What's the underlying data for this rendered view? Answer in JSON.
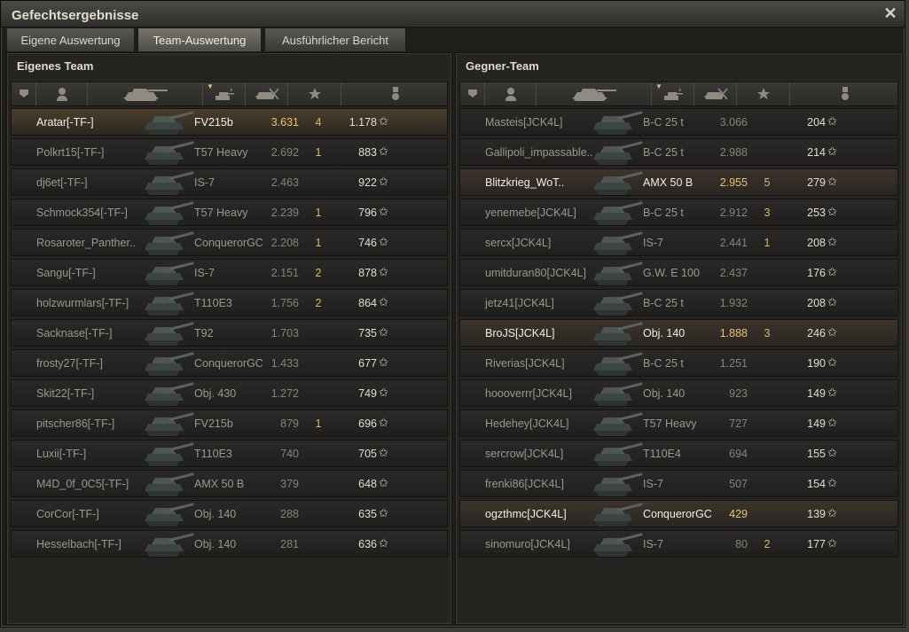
{
  "window": {
    "title": "Gefechtsergebnisse",
    "close_glyph": "✕"
  },
  "tabs": [
    {
      "label": "Eigene Auswertung"
    },
    {
      "label": "Team-Auswertung"
    },
    {
      "label": "Ausführlicher Bericht"
    }
  ],
  "active_tab": 1,
  "columns": [
    "squad-icon",
    "player-icon",
    "tank-icon",
    "damage-icon",
    "kills-icon",
    "xp-star-icon",
    "medal-icon"
  ],
  "own_team": {
    "title": "Eigenes Team",
    "rows": [
      {
        "name": "Aratar[-TF-]",
        "tank": "FV215b",
        "damage": "3.631",
        "kills": "4",
        "xp": "1.178",
        "style": "self"
      },
      {
        "name": "Polkrt15[-TF-]",
        "tank": "T57 Heavy",
        "damage": "2.692",
        "kills": "1",
        "xp": "883"
      },
      {
        "name": "dj6et[-TF-]",
        "tank": "IS-7",
        "damage": "2.463",
        "kills": "",
        "xp": "922"
      },
      {
        "name": "Schmock354[-TF-]",
        "tank": "T57 Heavy",
        "damage": "2.239",
        "kills": "1",
        "xp": "796"
      },
      {
        "name": "Rosaroter_Panther..",
        "tank": "ConquerorGC",
        "damage": "2.208",
        "kills": "1",
        "xp": "746"
      },
      {
        "name": "Sangu[-TF-]",
        "tank": "IS-7",
        "damage": "2.151",
        "kills": "2",
        "xp": "878"
      },
      {
        "name": "holzwurmlars[-TF-]",
        "tank": "T110E3",
        "damage": "1.756",
        "kills": "2",
        "xp": "864"
      },
      {
        "name": "Sacknase[-TF-]",
        "tank": "T92",
        "damage": "1.703",
        "kills": "",
        "xp": "735"
      },
      {
        "name": "frosty27[-TF-]",
        "tank": "ConquerorGC",
        "damage": "1.433",
        "kills": "",
        "xp": "677"
      },
      {
        "name": "Skit22[-TF-]",
        "tank": "Obj. 430",
        "damage": "1.272",
        "kills": "",
        "xp": "749"
      },
      {
        "name": "pitscher86[-TF-]",
        "tank": "FV215b",
        "damage": "879",
        "kills": "1",
        "xp": "696"
      },
      {
        "name": "Luxii[-TF-]",
        "tank": "T110E3",
        "damage": "740",
        "kills": "",
        "xp": "705"
      },
      {
        "name": "M4D_0f_0C5[-TF-]",
        "tank": "AMX 50 B",
        "damage": "379",
        "kills": "",
        "xp": "648"
      },
      {
        "name": "CorCor[-TF-]",
        "tank": "Obj. 140",
        "damage": "288",
        "kills": "",
        "xp": "635"
      },
      {
        "name": "Hesselbach[-TF-]",
        "tank": "Obj. 140",
        "damage": "281",
        "kills": "",
        "xp": "636"
      }
    ]
  },
  "enemy_team": {
    "title": "Gegner-Team",
    "rows": [
      {
        "name": "Masteis[JCK4L]",
        "tank": "B-C 25 t",
        "damage": "3.066",
        "kills": "",
        "xp": "204"
      },
      {
        "name": "Gallipoli_impassable..",
        "tank": "B-C 25 t",
        "damage": "2.988",
        "kills": "",
        "xp": "214"
      },
      {
        "name": "Blitzkrieg_WoT..",
        "tank": "AMX 50 B",
        "damage": "2.955",
        "kills": "5",
        "xp": "279",
        "style": "bright"
      },
      {
        "name": "yenemebe[JCK4L]",
        "tank": "B-C 25 t",
        "damage": "2.912",
        "kills": "3",
        "xp": "253"
      },
      {
        "name": "sercx[JCK4L]",
        "tank": "IS-7",
        "damage": "2.441",
        "kills": "1",
        "xp": "208"
      },
      {
        "name": "umitduran80[JCK4L]",
        "tank": "G.W. E 100",
        "damage": "2.437",
        "kills": "",
        "xp": "176"
      },
      {
        "name": "jetz41[JCK4L]",
        "tank": "B-C 25 t",
        "damage": "1.932",
        "kills": "",
        "xp": "208"
      },
      {
        "name": "BroJS[JCK4L]",
        "tank": "Obj. 140",
        "damage": "1.888",
        "kills": "3",
        "xp": "246",
        "style": "bright"
      },
      {
        "name": "Riverias[JCK4L]",
        "tank": "B-C 25 t",
        "damage": "1.251",
        "kills": "",
        "xp": "190"
      },
      {
        "name": "hooоverrr[JCK4L]",
        "tank": "Obj. 140",
        "damage": "923",
        "kills": "",
        "xp": "149"
      },
      {
        "name": "Hedehey[JCK4L]",
        "tank": "T57 Heavy",
        "damage": "727",
        "kills": "",
        "xp": "149"
      },
      {
        "name": "sercrow[JCK4L]",
        "tank": "T110E4",
        "damage": "694",
        "kills": "",
        "xp": "155"
      },
      {
        "name": "frenki86[JCK4L]",
        "tank": "IS-7",
        "damage": "507",
        "kills": "",
        "xp": "154"
      },
      {
        "name": "ogzthmc[JCK4L]",
        "tank": "ConquerorGC",
        "damage": "429",
        "kills": "",
        "xp": "139",
        "style": "bright"
      },
      {
        "name": "sinomuro[JCK4L]",
        "tank": "IS-7",
        "damage": "80",
        "kills": "2",
        "xp": "177"
      }
    ]
  },
  "star_glyph": "✩",
  "colors": {
    "self_row": "#4c3d2a",
    "damage_highlight": "#e4c570",
    "kills": "#dab965"
  }
}
